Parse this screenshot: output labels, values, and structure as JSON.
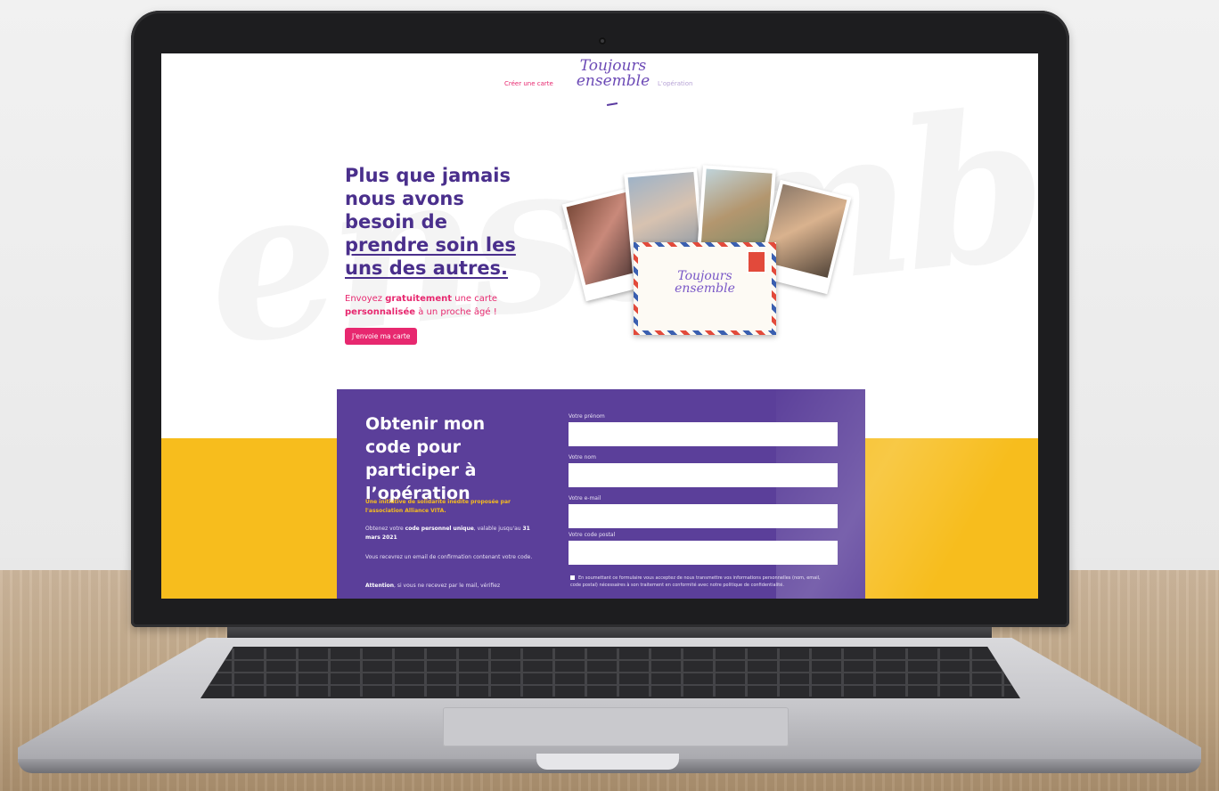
{
  "site": {
    "nav_left": "Créer une carte",
    "nav_right": "L'opération",
    "logo_text": "Toujours ensemble",
    "watermark": "ensemble"
  },
  "hero": {
    "title_part1": "Plus que jamais nous avons besoin de ",
    "title_underlined": "prendre soin les uns des autres.",
    "sub_pre": "Envoyez ",
    "sub_bold1": "gratuitement",
    "sub_mid": " une carte ",
    "sub_bold2": "personnalisée",
    "sub_post": " à un proche âgé !",
    "cta": "J'envoie ma carte",
    "envelope_logo": "Toujours ensemble"
  },
  "form_section": {
    "title": "Obtenir mon code pour participer à l’opération",
    "intro": "Une initiative de solidarité inédite proposée par l'association Alliance VITA.",
    "p1_pre": "Obtenez votre ",
    "p1_bold": "code personnel unique",
    "p1_mid": ", valable jusqu'au ",
    "p1_bold2": "31 mars 2021",
    "p2": "Vous recevrez un email de confirmation contenant votre code.",
    "p3_bold": "Attention",
    "p3": ", si vous ne recevez par le mail, vérifiez",
    "fields": {
      "first_name_label": "Votre prénom",
      "last_name_label": "Votre nom",
      "email_label": "Votre e-mail",
      "postal_label": "Votre code postal"
    },
    "consent": "En soumettant ce formulaire vous acceptez de nous transmettre vos informations personnelles (nom, email, code postal) nécessaires à son traitement en conformité avec notre politique de confidentialité."
  },
  "colors": {
    "purple": "#5b3f9a",
    "pink": "#e7286f",
    "yellow": "#f7bd1d"
  }
}
